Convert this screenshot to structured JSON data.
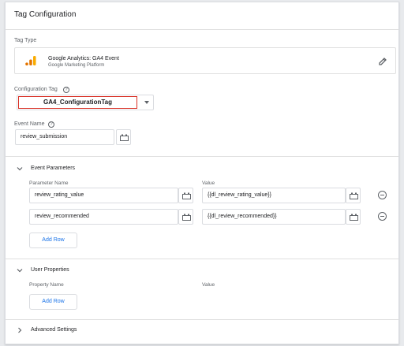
{
  "title": "Tag Configuration",
  "tag_type": {
    "label": "Tag Type",
    "name": "Google Analytics: GA4 Event",
    "platform": "Google Marketing Platform",
    "icon": "google-analytics-icon",
    "edit_icon": "pencil-icon"
  },
  "configuration_tag": {
    "label": "Configuration Tag",
    "help_icon": "?",
    "value": "GA4_ConfigurationTag"
  },
  "event_name": {
    "label": "Event Name",
    "help_icon": "?",
    "value": "review_submission"
  },
  "event_parameters": {
    "title": "Event Parameters",
    "col_name": "Parameter Name",
    "col_value": "Value",
    "rows": [
      {
        "name": "review_rating_value",
        "value": "{{dl_review_rating_value}}"
      },
      {
        "name": "review_recommended",
        "value": "{{dl_review_recommended}}"
      }
    ],
    "add_label": "Add Row"
  },
  "user_properties": {
    "title": "User Properties",
    "col_name": "Property Name",
    "col_value": "Value",
    "add_label": "Add Row"
  },
  "advanced": {
    "title": "Advanced Settings"
  },
  "colors": {
    "accent": "#1a73e8",
    "highlight": "#d93025",
    "ga_orange": "#f9ab00",
    "ga_dark_orange": "#e37400"
  }
}
